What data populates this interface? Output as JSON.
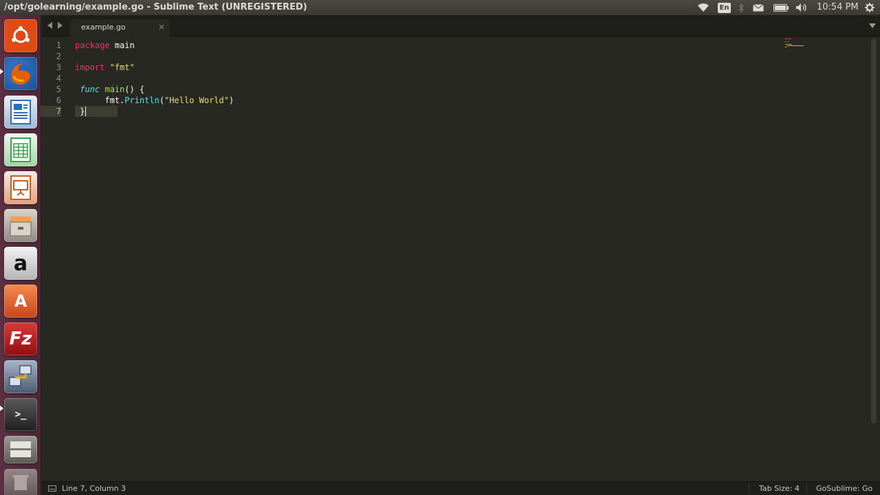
{
  "top_panel": {
    "window_title": "/opt/golearning/example.go - Sublime Text (UNREGISTERED)",
    "keyboard_layout": "En",
    "clock": "10:54 PM",
    "tray_icons": [
      "wifi-icon",
      "keyboard-layout-indicator",
      "bluetooth-icon",
      "mail-icon",
      "battery-icon",
      "volume-icon",
      "session-gear-icon"
    ]
  },
  "launcher": {
    "items": [
      {
        "name": "dash-home",
        "icon": "ubuntu-logo-icon",
        "color": "#df4a16"
      },
      {
        "name": "firefox",
        "icon": "firefox-icon",
        "color": "#e66000"
      },
      {
        "name": "libreoffice-writer",
        "icon": "writer-icon",
        "color": "#2a6fbf"
      },
      {
        "name": "libreoffice-calc",
        "icon": "calc-icon",
        "color": "#3aa24a"
      },
      {
        "name": "libreoffice-impress",
        "icon": "impress-icon",
        "color": "#d35a1d"
      },
      {
        "name": "files",
        "icon": "file-cabinet-icon",
        "color": "#a8a49a"
      },
      {
        "name": "amazon",
        "icon": "amazon-icon",
        "color": "#c8c8c8",
        "glyph": "a"
      },
      {
        "name": "software-center",
        "icon": "shopping-bag-icon",
        "color": "#e95420",
        "glyph": "A"
      },
      {
        "name": "filezilla",
        "icon": "filezilla-icon",
        "color": "#bf1e1e",
        "glyph": "Fz"
      },
      {
        "name": "network-tool",
        "icon": "network-computers-icon",
        "color": "#5a6b86"
      },
      {
        "name": "terminal",
        "icon": "terminal-icon",
        "color": "#2e2e2e",
        "glyph": ">_"
      },
      {
        "name": "workspace-switcher",
        "icon": "workspace-icon",
        "color": "#6d6b66"
      }
    ]
  },
  "editor": {
    "tab": {
      "label": "example.go",
      "close": "×"
    },
    "line_numbers": [
      "1",
      "2",
      "3",
      "4",
      "5",
      "6",
      "7"
    ],
    "code": {
      "l1_kw": "package",
      "l1_rest": " main",
      "l3_kw": "import",
      "l3_str": " \"fmt\"",
      "l5_func": " func",
      "l5_name": " main",
      "l5_rest": "() {",
      "l6_pkg": "      fmt.",
      "l6_fn": "Println",
      "l6_open": "(",
      "l6_str": "\"Hello World\"",
      "l6_close": ")",
      "l7": " }"
    }
  },
  "status_bar": {
    "position": "Line 7, Column 3",
    "tab_size": "Tab Size: 4",
    "syntax": "GoSublime: Go"
  },
  "theme": {
    "editor_bg": "#272822",
    "keyword": "#f92672",
    "storage": "#66d9ef",
    "function": "#a6e22e",
    "string": "#e6db74"
  }
}
